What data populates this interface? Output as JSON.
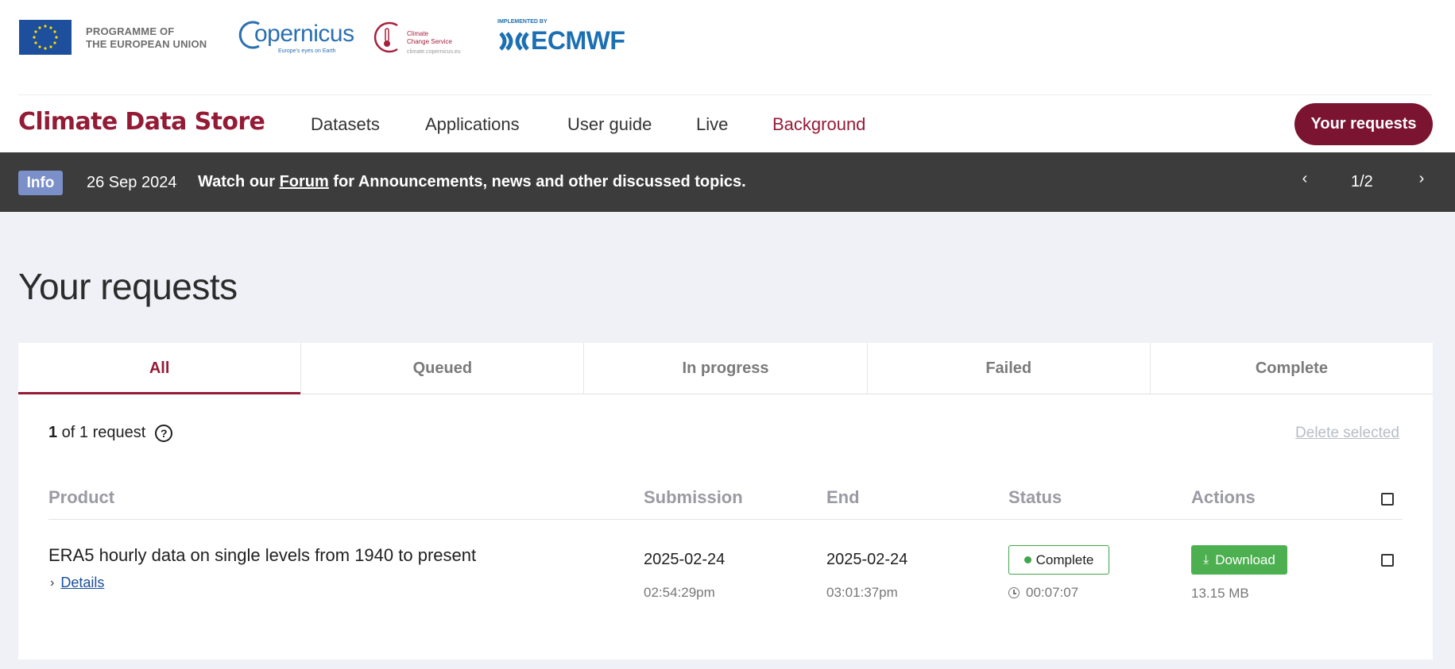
{
  "logos": {
    "eu_line1": "PROGRAMME OF",
    "eu_line2": "THE EUROPEAN UNION",
    "copernicus_word": "opernicus",
    "copernicus_tagline": "Europe's eyes on Earth",
    "c3s_line1": "Climate",
    "c3s_line2": "Change Service",
    "c3s_url": "climate.copernicus.eu",
    "ecmwf_implemented": "IMPLEMENTED BY",
    "ecmwf_word": "ECMWF"
  },
  "nav": {
    "brand": "Climate Data Store",
    "links": [
      "Datasets",
      "Applications",
      "User guide",
      "Live",
      "Background"
    ],
    "active_link": "Background",
    "requests_button": "Your requests"
  },
  "infobar": {
    "badge": "Info",
    "date": "26 Sep 2024",
    "message_prefix": "Watch our ",
    "message_link": "Forum",
    "message_suffix": " for Announcements, news and other discussed topics.",
    "pager": "1/2"
  },
  "page": {
    "title": "Your requests"
  },
  "tabs": {
    "items": [
      "All",
      "Queued",
      "In progress",
      "Failed",
      "Complete"
    ],
    "active": "All"
  },
  "requests": {
    "count_shown": "1",
    "count_of": " of ",
    "count_total": "1",
    "count_unit": " request",
    "delete_selected": "Delete selected",
    "columns": {
      "product": "Product",
      "submission": "Submission",
      "end": "End",
      "status": "Status",
      "actions": "Actions"
    },
    "rows": [
      {
        "product": "ERA5 hourly data on single levels from 1940 to present",
        "details_label": "Details",
        "submission_date": "2025-02-24",
        "submission_time": "02:54:29pm",
        "end_date": "2025-02-24",
        "end_time": "03:01:37pm",
        "status": "Complete",
        "duration": "00:07:07",
        "action": "Download",
        "size": "13.15 MB"
      }
    ]
  },
  "colors": {
    "brand": "#941b36",
    "button_dark": "#7b1430",
    "info_badge": "#7b8fc8",
    "success": "#4caf50"
  }
}
